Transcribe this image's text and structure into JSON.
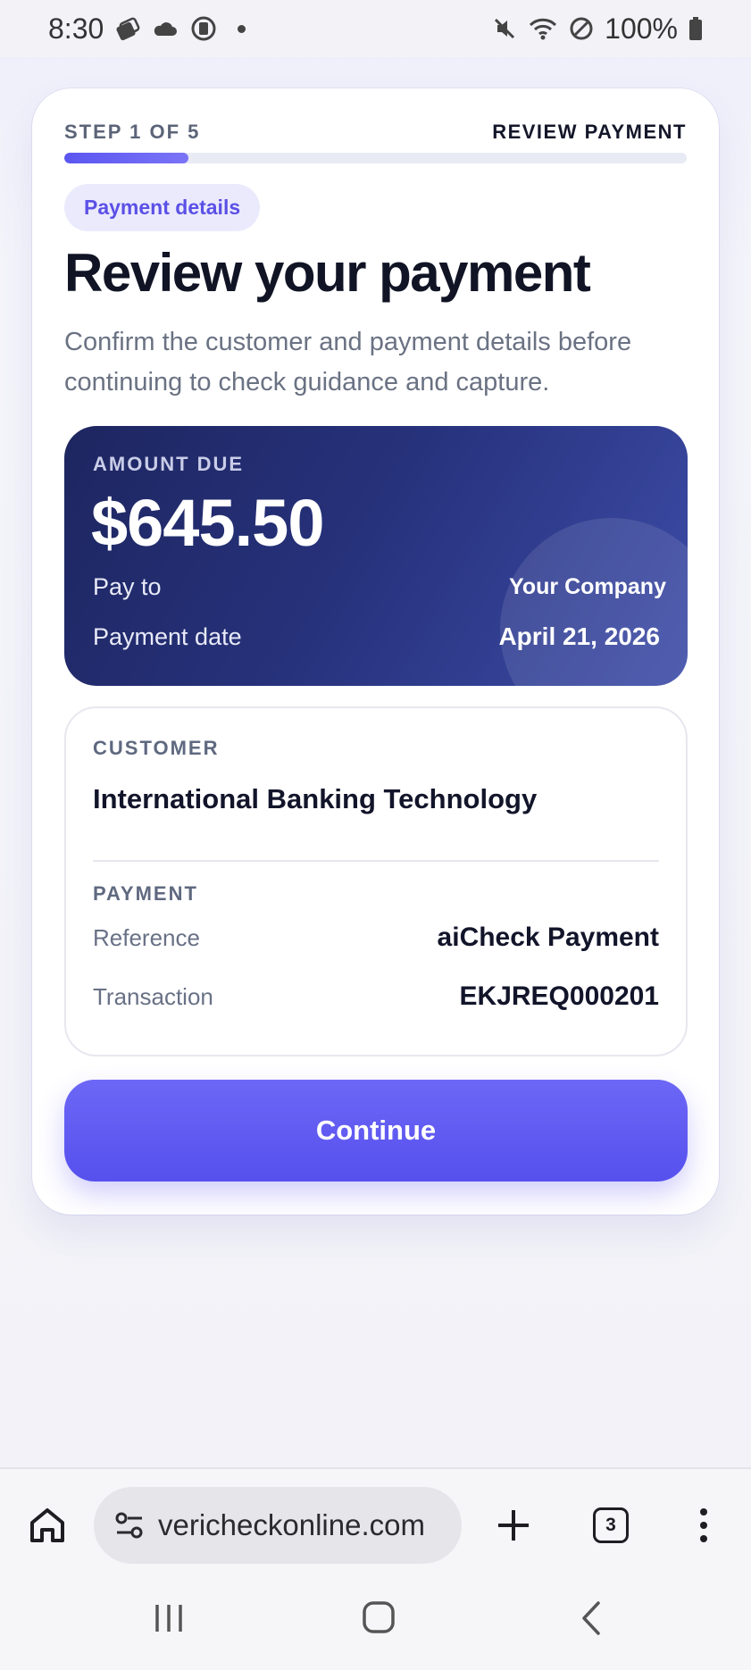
{
  "status_bar": {
    "time": "8:30",
    "battery": "100%",
    "icons_left": [
      "notification-stack-icon",
      "cloud-icon",
      "screen-record-icon",
      "dot-icon"
    ],
    "icons_right": [
      "mute-icon",
      "wifi-icon",
      "do-not-disturb-icon",
      "battery-icon"
    ]
  },
  "stepper": {
    "label": "STEP 1 OF 5",
    "title": "REVIEW PAYMENT",
    "progress": 0.2
  },
  "chip": "Payment details",
  "headline": "Review your payment",
  "subtext": "Confirm the customer and payment details before continuing to check guidance and capture.",
  "amount": {
    "label": "AMOUNT DUE",
    "value": "$645.50",
    "pay_to_label": "Pay to",
    "pay_to_value": "Your Company",
    "date_label": "Payment date",
    "date_value": "April 21, 2026"
  },
  "customer": {
    "label": "CUSTOMER",
    "name": "International Banking Technology"
  },
  "payment": {
    "label": "PAYMENT",
    "reference_label": "Reference",
    "reference_value": "aiCheck Payment",
    "transaction_label": "Transaction",
    "transaction_value": "EKJREQ000201"
  },
  "continue_label": "Continue",
  "browser": {
    "url": "vericheckonline.com",
    "tab_count": "3"
  },
  "colors": {
    "accent": "#5B56F0",
    "panel_dark": "#1E2660",
    "text_primary": "#101425",
    "text_secondary": "#6A7283"
  }
}
